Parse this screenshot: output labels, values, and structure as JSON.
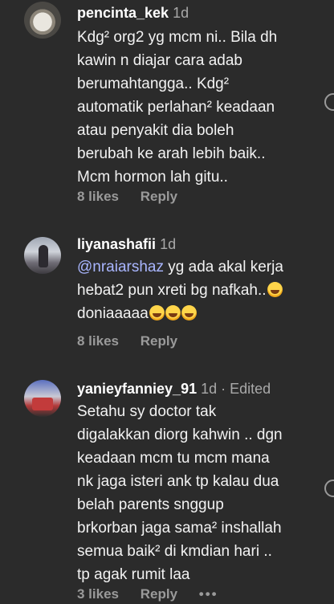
{
  "comments": [
    {
      "username": "pencinta_kek",
      "time": "1d",
      "edited": "",
      "lines": [
        "Kdg² org2 yg mcm ni.. Bila dh",
        "kawin n diajar cara adab",
        "berumahtangga.. Kdg²",
        "automatik perlahan² keadaan",
        "atau penyakit dia boleh",
        "berubah ke arah lebih baik..",
        "Mcm hormon lah gitu.."
      ],
      "likes": "8 likes",
      "reply": "Reply"
    },
    {
      "username": "liyanashafii",
      "time": "1d",
      "edited": "",
      "mention": "@nraiarshaz",
      "line1_rest": " yg ada akal kerja",
      "line2": "hebat2 pun xreti bg nafkah..",
      "line3": "doniaaaaa",
      "likes": "8 likes",
      "reply": "Reply"
    },
    {
      "username": "yanieyfanniey_91",
      "time": "1d",
      "edited": " · Edited",
      "lines": [
        "Setahu sy doctor tak",
        "digalakkan diorg kahwin .. dgn",
        "keadaan mcm tu mcm mana",
        "nk jaga isteri ank tp kalau dua",
        "belah parents snggup",
        "brkorban jaga sama² inshallah",
        "semua baik² di kmdian hari ..",
        "tp agak rumit laa"
      ],
      "likes": "3 likes",
      "reply": "Reply",
      "more": "•••"
    }
  ]
}
